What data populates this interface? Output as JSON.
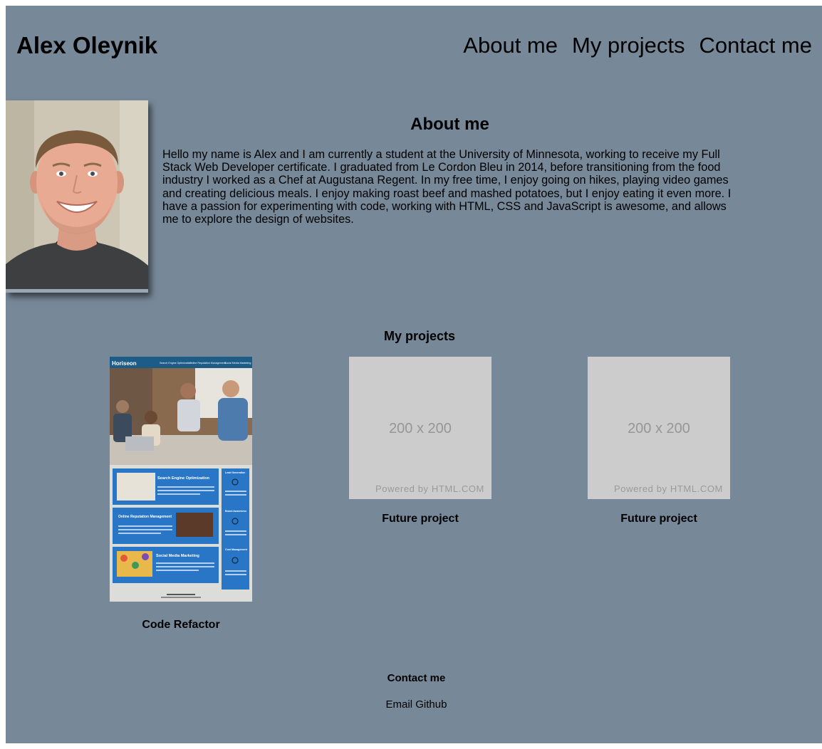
{
  "header": {
    "site_title": "Alex Oleynik",
    "nav": [
      "About me",
      "My projects",
      "Contact me"
    ]
  },
  "about": {
    "heading": "About me",
    "text": "Hello my name is Alex and I am currently a student at the University of Minnesota, working to receive my Full Stack Web Developer certificate. I graduated from Le Cordon Bleu in 2014, before transitioning from the food industry I worked as a Chef at Augustana Regent. In my free time, I enjoy going on hikes, playing video games and creating delicious meals. I enjoy making roast beef and mashed potatoes, but I enjoy eating it even more. I have a passion for experimenting with code, working with HTML, CSS and JavaScript is awesome, and allows me to explore the design of websites."
  },
  "projects": {
    "heading": "My projects",
    "items": [
      {
        "caption": "Code Refactor",
        "thumb": {
          "brand": "Horiseon",
          "nav": [
            "Search Engine Optimization",
            "Online Reputation Management",
            "Social Media Marketing"
          ],
          "cards": [
            "Search Engine Optimization",
            "Online Reputation Management",
            "Social Media Marketing"
          ],
          "side": [
            "Lead Generation",
            "Brand Awareness",
            "Cost Management"
          ]
        }
      },
      {
        "caption": "Future project",
        "placeholder_size": "200 x 200",
        "placeholder_credit": "Powered by HTML.COM"
      },
      {
        "caption": "Future project",
        "placeholder_size": "200 x 200",
        "placeholder_credit": "Powered by HTML.COM"
      }
    ]
  },
  "contact": {
    "heading": "Contact me",
    "links": [
      "Email",
      "Github"
    ]
  },
  "colors": {
    "page_background": "#778899",
    "placeholder": "#cccccc",
    "thumb_header": "#1d5c86",
    "thumb_card": "#2a76c6"
  }
}
